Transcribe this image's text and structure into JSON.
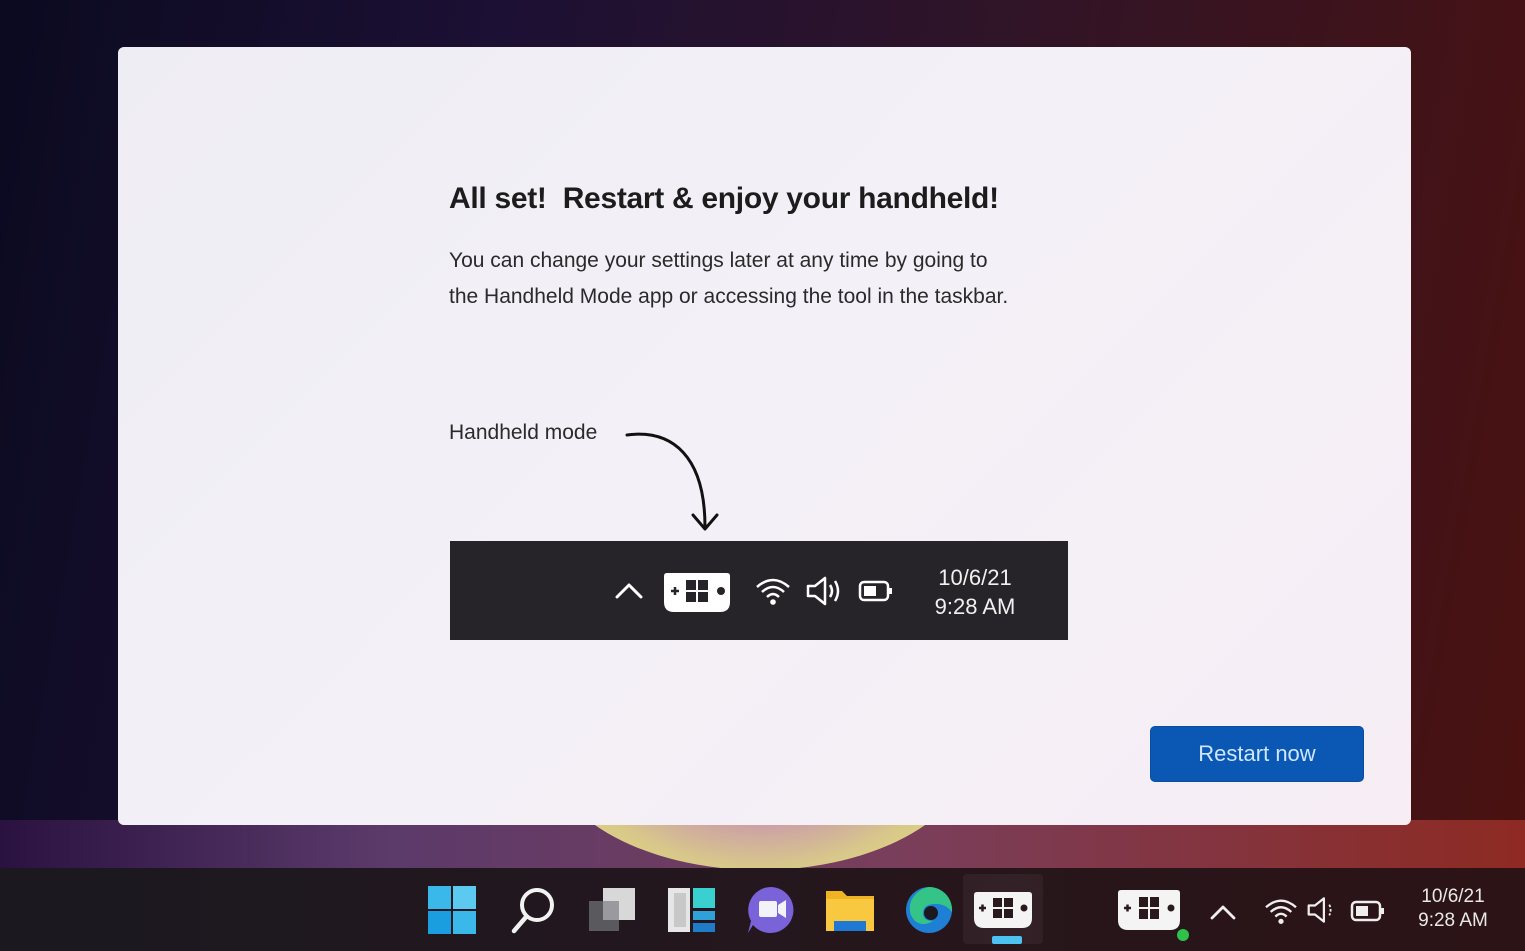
{
  "dialog": {
    "title": "All set!  Restart & enjoy your handheld!",
    "description_line1": "You can change your settings later at any time by going to",
    "description_line2": "the Handheld Mode app or accessing the tool in the taskbar.",
    "annotation_label": "Handheld mode",
    "preview_taskbar": {
      "icons": [
        "chevron-up-icon",
        "handheld-mode-icon",
        "wifi-icon",
        "volume-icon",
        "battery-icon"
      ],
      "date": "10/6/21",
      "time": "9:28 AM"
    },
    "restart_button_label": "Restart now",
    "accent_color": "#0a58b4"
  },
  "taskbar": {
    "pinned": [
      "start",
      "search",
      "task-view",
      "widgets",
      "chat",
      "file-explorer",
      "edge",
      "handheld-mode"
    ],
    "active_app": "handheld-mode",
    "tray_icons": [
      "handheld-mode-icon",
      "chevron-up-icon",
      "wifi-icon",
      "volume-icon",
      "battery-icon"
    ],
    "date": "10/6/21",
    "time": "9:28 AM",
    "indicator_color": "#4cc2f0",
    "status_dot_color": "#2ec24a"
  }
}
